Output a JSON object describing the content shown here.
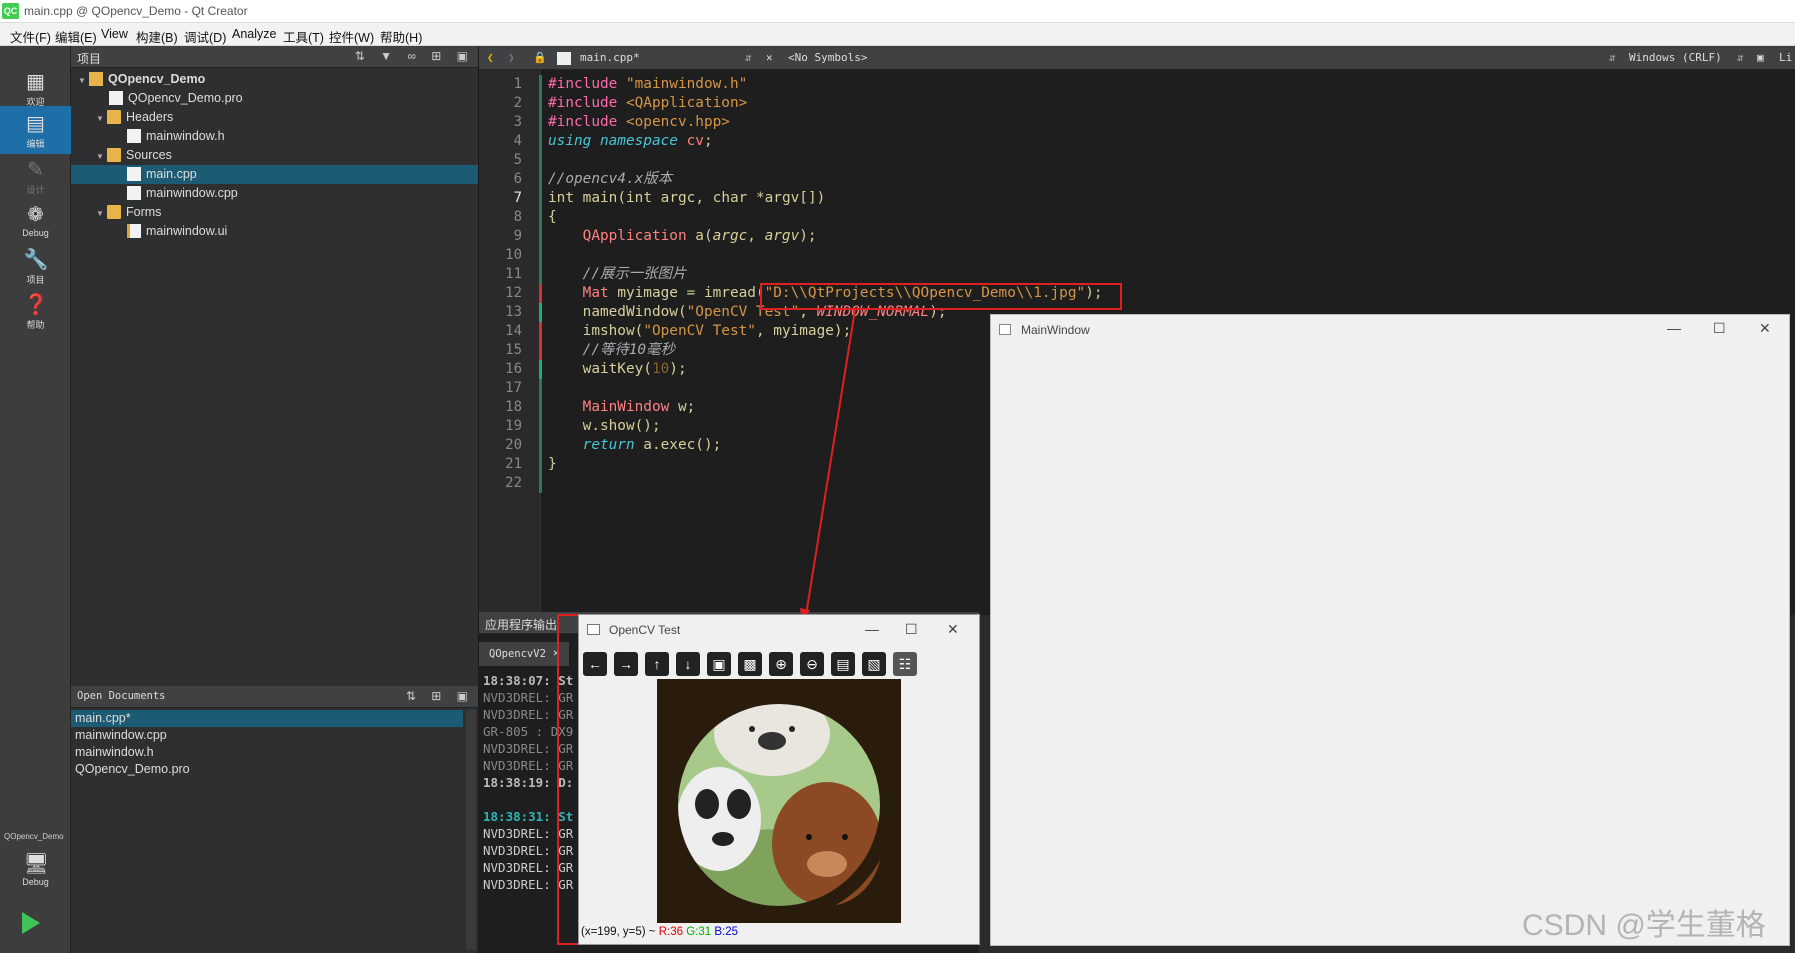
{
  "window": {
    "title": "main.cpp @ QOpencv_Demo - Qt Creator",
    "logo": "QC"
  },
  "menu": [
    "文件(F)",
    "编辑(E)",
    "View",
    "构建(B)",
    "调试(D)",
    "Analyze",
    "工具(T)",
    "控件(W)",
    "帮助(H)"
  ],
  "modes": [
    {
      "label": "欢迎",
      "icon": "grid-icon"
    },
    {
      "label": "编辑",
      "icon": "edit-icon"
    },
    {
      "label": "设计",
      "icon": "pencil-icon"
    },
    {
      "label": "Debug",
      "icon": "bug-icon"
    },
    {
      "label": "项目",
      "icon": "wrench-icon"
    },
    {
      "label": "帮助",
      "icon": "help-icon"
    }
  ],
  "kit": {
    "project": "QOpencv_Demo",
    "config": "Debug"
  },
  "projects_panel": {
    "title": "项目",
    "tree": [
      {
        "label": "QOpencv_Demo",
        "kind": "project"
      },
      {
        "label": "QOpencv_Demo.pro",
        "kind": "pro"
      },
      {
        "label": "Headers",
        "kind": "folder"
      },
      {
        "label": "mainwindow.h",
        "kind": "file"
      },
      {
        "label": "Sources",
        "kind": "folder"
      },
      {
        "label": "main.cpp",
        "kind": "file",
        "selected": true
      },
      {
        "label": "mainwindow.cpp",
        "kind": "file"
      },
      {
        "label": "Forms",
        "kind": "folder"
      },
      {
        "label": "mainwindow.ui",
        "kind": "ui"
      }
    ]
  },
  "open_documents": {
    "title": "Open Documents",
    "items": [
      "main.cpp*",
      "mainwindow.cpp",
      "mainwindow.h",
      "QOpencv_Demo.pro"
    ]
  },
  "editor": {
    "file": "main.cpp*",
    "symbols": "<No Symbols>",
    "line_ending": "Windows (CRLF)",
    "extra": "Li",
    "line_numbers": [
      "1",
      "2",
      "3",
      "4",
      "5",
      "6",
      "7",
      "8",
      "9",
      "10",
      "11",
      "12",
      "13",
      "14",
      "15",
      "16",
      "17",
      "18",
      "19",
      "20",
      "21",
      "22"
    ]
  },
  "output": {
    "title": "应用程序输出",
    "tab": "QOpencvV2",
    "lines": [
      "18:38:07: St",
      "NVD3DREL: GR",
      "NVD3DREL: GR",
      "GR-805 : DX9",
      "NVD3DREL: GR",
      "NVD3DREL: GR",
      "18:38:19: D:",
      "",
      "18:38:31: St",
      "NVD3DREL: GR",
      "NVD3DREL: GR",
      "NVD3DREL: GR",
      "NVD3DREL: GR"
    ]
  },
  "opencv_window": {
    "title": "OpenCV Test",
    "toolbar": [
      "pan-left-icon",
      "pan-right-icon",
      "pan-up-icon",
      "pan-down-icon",
      "image-icon",
      "image-copy-icon",
      "zoom-in-icon",
      "zoom-out-icon",
      "save-icon",
      "clipboard-icon",
      "properties-icon"
    ],
    "status_prefix": "(x=199, y=5) ~",
    "r": "R:36",
    "g": "G:31",
    "b": "B:25"
  },
  "main_window": {
    "title": "MainWindow"
  },
  "watermark": "CSDN @学生董格"
}
